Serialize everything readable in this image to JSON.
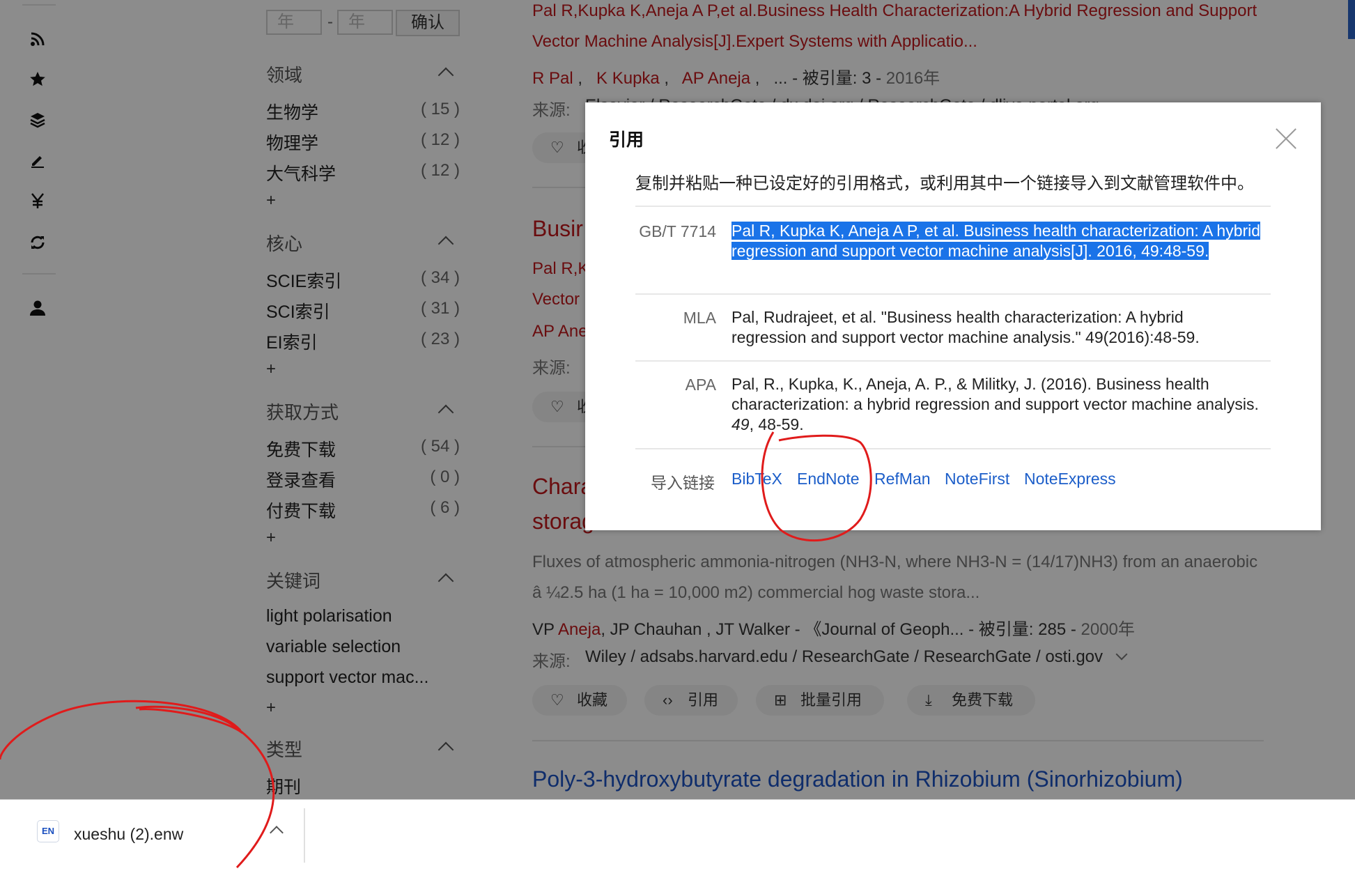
{
  "filters": {
    "year_from_placeholder": "年",
    "year_to_placeholder": "年",
    "year_dash": "-",
    "confirm_label": "确认",
    "plus": "+",
    "groups": [
      {
        "title": "领域",
        "items": [
          [
            "生物学",
            "( 15 )"
          ],
          [
            "物理学",
            "( 12 )"
          ],
          [
            "大气科学",
            "( 12 )"
          ]
        ]
      },
      {
        "title": "核心",
        "items": [
          [
            "SCIE索引",
            "( 34 )"
          ],
          [
            "SCI索引",
            "( 31 )"
          ],
          [
            "EI索引",
            "( 23 )"
          ]
        ]
      },
      {
        "title": "获取方式",
        "items": [
          [
            "免费下载",
            "( 54 )"
          ],
          [
            "登录查看",
            "( 0 )"
          ],
          [
            "付费下载",
            "( 6 )"
          ]
        ]
      },
      {
        "title": "关键词",
        "items": [
          [
            "light polarisation",
            ""
          ],
          [
            "variable selection",
            ""
          ],
          [
            "support vector mac...",
            ""
          ]
        ]
      },
      {
        "title": "类型",
        "items": [
          [
            "期刊",
            ""
          ]
        ]
      }
    ]
  },
  "results": {
    "r1": {
      "title_line1": "Pal R,Kupka K,Aneja A P,et al.Business Health Characterization:A Hybrid Regression and Support",
      "title_line2": "Vector Machine Analysis[J].Expert Systems with Applicatio...",
      "author1": "R Pal",
      "author2": "K Kupka",
      "author3": "AP Aneja",
      "meta_tail": "... - 被引量: 3 - ",
      "year": "2016年",
      "source_label": "来源:",
      "source_list": "Elsevier / ResearchGate / dx.doi.org / ResearchGate / dlive.portal.org",
      "fav_label": "收藏"
    },
    "r2": {
      "title_fragment": "Busir",
      "line1_fragment": "Pal R,K",
      "line2_fragment": "Vector",
      "author_fragment": "AP Ane",
      "source_label": "来源:",
      "fav_label": "收藏"
    },
    "r3": {
      "title_line1_fragment": "Chara",
      "title_line2_fragment": "storag",
      "abstract_line1": "Fluxes of atmospheric ammonia-nitrogen (NH3-N, where NH3-N = (14/17)NH3) from an anaerobic",
      "abstract_line2": "â ¼2.5 ha (1 ha = 10,000 m2) commercial hog waste stora...",
      "author_vp": "VP ",
      "author_vp_name": "Aneja",
      "meta": ", JP Chauhan , JT Walker - 《Journal of Geoph... - 被引量: 285 - ",
      "year": "2000年",
      "source_label": "来源:",
      "source_list": "Wiley / adsabs.harvard.edu / ResearchGate / ResearchGate / osti.gov",
      "actions": {
        "fav": "收藏",
        "cite": "引用",
        "batch": "批量引用",
        "download": "免费下载"
      }
    },
    "r4": {
      "title": "Poly-3-hydroxybutyrate degradation in Rhizobium (Sinorhizobium)"
    }
  },
  "modal": {
    "title": "引用",
    "description": "复制并粘贴一种已设定好的引用格式，或利用其中一个链接导入到文献管理软件中。",
    "citations": {
      "gbt": {
        "label": "GB/T 7714",
        "text": "Pal R, Kupka K, Aneja A P, et al. Business health characterization: A hybrid regression and support vector machine analysis[J]. 2016, 49:48-59."
      },
      "mla": {
        "label": "MLA",
        "text": "Pal, Rudrajeet, et al. \"Business health characterization: A hybrid regression and support vector machine analysis.\" 49(2016):48-59."
      },
      "apa": {
        "label": "APA",
        "text_before": "Pal, R., Kupka, K., Aneja, A. P., & Militky, J. (2016). Business health characterization: a hybrid regression and support vector machine analysis. ",
        "volume": "49",
        "text_after": ", 48-59."
      }
    },
    "import_label": "导入链接",
    "import_links": [
      "BibTeX",
      "EndNote",
      "RefMan",
      "NoteFirst",
      "NoteExpress"
    ]
  },
  "download_bar": {
    "icon_text": "EN",
    "file_name": "xueshu (2).enw"
  },
  "colors": {
    "highlight": "#1a73e8",
    "link": "#1c5ec9",
    "author_red": "#c2181d",
    "annotation_red": "#e01b1b"
  }
}
